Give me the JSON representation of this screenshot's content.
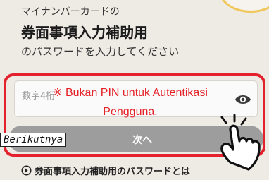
{
  "heading": {
    "line1": "マイナンバーカードの",
    "line2": "券面事項入力補助用",
    "line3": "のパスワードを入力してください"
  },
  "pin_field": {
    "placeholder": "数字4桁",
    "toggle_icon": "eye-icon"
  },
  "next_button": {
    "label": "次へ"
  },
  "overlay": {
    "warning_line1": "※ Bukan PIN untuk Autentikasi",
    "warning_line2": "Pengguna.",
    "caption": "Berikutnya",
    "pointer_icon": "tapping-hand-icon",
    "frame_color": "#e3222e"
  },
  "help_link": {
    "label": "券面事項入力補助用のパスワードとは",
    "icon": "circle-arrow-icon"
  },
  "colors": {
    "background": "#eeeae4",
    "button_bg": "#9d9d9d",
    "warning_text": "#e52228",
    "accent_yellow": "#f0c75a"
  }
}
